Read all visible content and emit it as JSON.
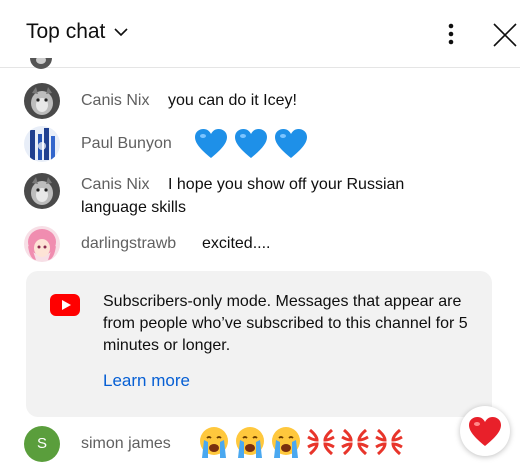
{
  "header": {
    "title": "Top chat"
  },
  "messages": [
    {
      "author": "Canis Nix",
      "text": "you can do it Icey!"
    },
    {
      "author": "Paul Bunyon",
      "emoji": "blue-heart x3"
    },
    {
      "author": "Canis Nix",
      "text_line1": "I hope you show off your Russian",
      "text_line2": "language skills"
    },
    {
      "author": "darlingstrawb",
      "text": "excited...."
    },
    {
      "author": "simon james",
      "avatar_letter": "S",
      "emoji": "loudly-crying-face x3, anger-symbol x3"
    }
  ],
  "notice": {
    "text": "Subscribers-only mode. Messages that appear are from people who’ve subscribed to this channel for 5 minutes or longer.",
    "link": "Learn more"
  },
  "colors": {
    "link": "#065fd4",
    "youtube_red": "#ff0000",
    "notice_bg": "#f2f2f2",
    "simon_avatar": "#5a9e3c"
  }
}
